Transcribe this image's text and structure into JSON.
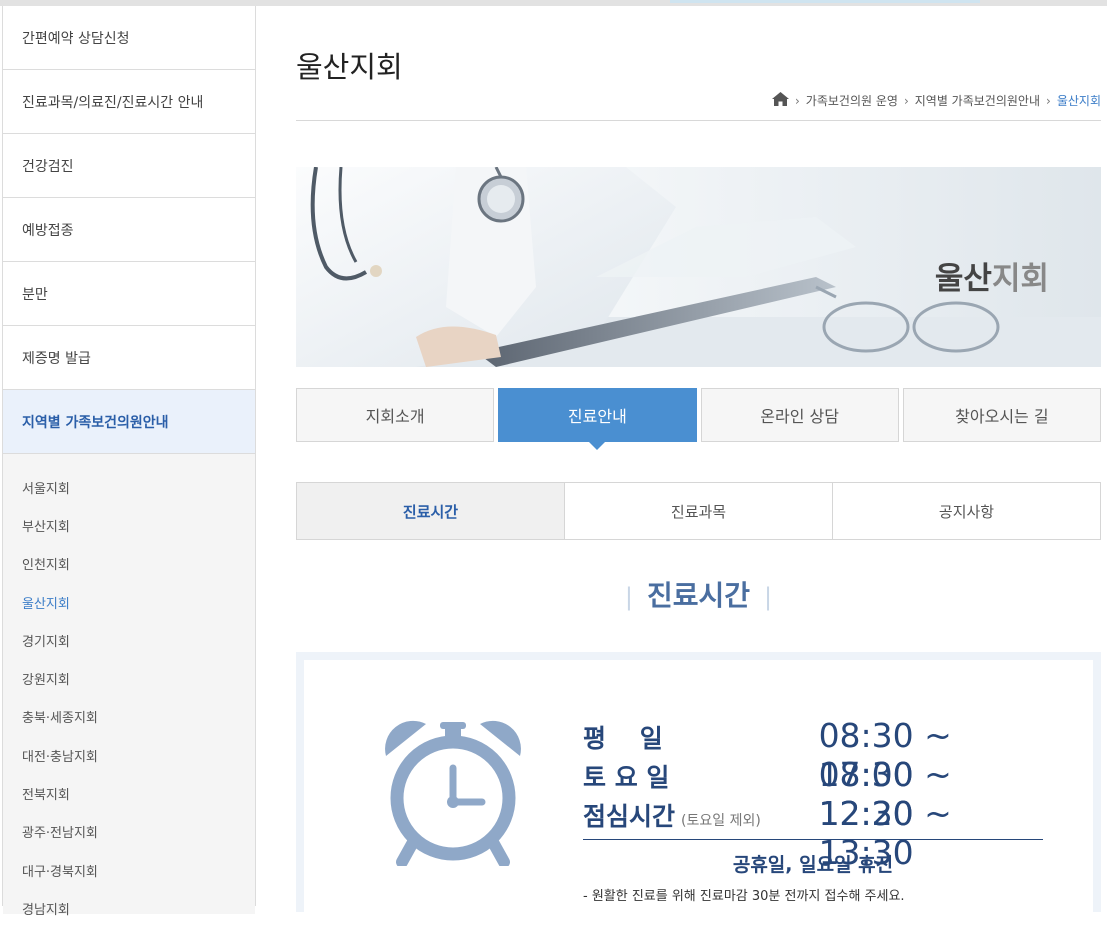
{
  "sidebar": {
    "items": [
      {
        "label": "간편예약 상담신청"
      },
      {
        "label": "진료과목/의료진/진료시간 안내"
      },
      {
        "label": "건강검진"
      },
      {
        "label": "예방접종"
      },
      {
        "label": "분만"
      },
      {
        "label": "제증명 발급"
      },
      {
        "label": "지역별 가족보건의원안내"
      }
    ],
    "submenu": [
      {
        "label": "서울지회"
      },
      {
        "label": "부산지회"
      },
      {
        "label": "인천지회"
      },
      {
        "label": "울산지회"
      },
      {
        "label": "경기지회"
      },
      {
        "label": "강원지회"
      },
      {
        "label": "충북·세종지회"
      },
      {
        "label": "대전·충남지회"
      },
      {
        "label": "전북지회"
      },
      {
        "label": "광주·전남지회"
      },
      {
        "label": "대구·경북지회"
      },
      {
        "label": "경남지회"
      }
    ]
  },
  "page": {
    "title": "울산지회",
    "breadcrumb": [
      "가족보건의원 운영",
      "지역별 가족보건의원안내",
      "울산지회"
    ]
  },
  "banner": {
    "title_bold": "울산",
    "title_light": "지회"
  },
  "tabs": [
    {
      "label": "지회소개"
    },
    {
      "label": "진료안내"
    },
    {
      "label": "온라인 상담"
    },
    {
      "label": "찾아오시는 길"
    }
  ],
  "subtabs": [
    {
      "label": "진료시간"
    },
    {
      "label": "진료과목"
    },
    {
      "label": "공지사항"
    }
  ],
  "section": {
    "title": "진료시간"
  },
  "hours": {
    "weekday_label": "평　 일",
    "weekday_time": "08:30 ~ 17:00",
    "saturday_label": "토 요 일",
    "saturday_time": "08:30 ~ 12:20",
    "lunch_label": "점심시간",
    "lunch_note": "(토요일 제외)",
    "lunch_time": "12:30 ~ 13:30",
    "holiday": "공휴일, 일요일 휴진",
    "notice": "- 원활한 진료를 위해 진료마감 30분 전까지 접수해 주세요."
  },
  "colors": {
    "accent": "#4a8fd1",
    "navy": "#27477a",
    "clock": "#8fa8c8"
  },
  "icons": {
    "home": "home-icon",
    "clock": "alarm-clock-icon"
  }
}
